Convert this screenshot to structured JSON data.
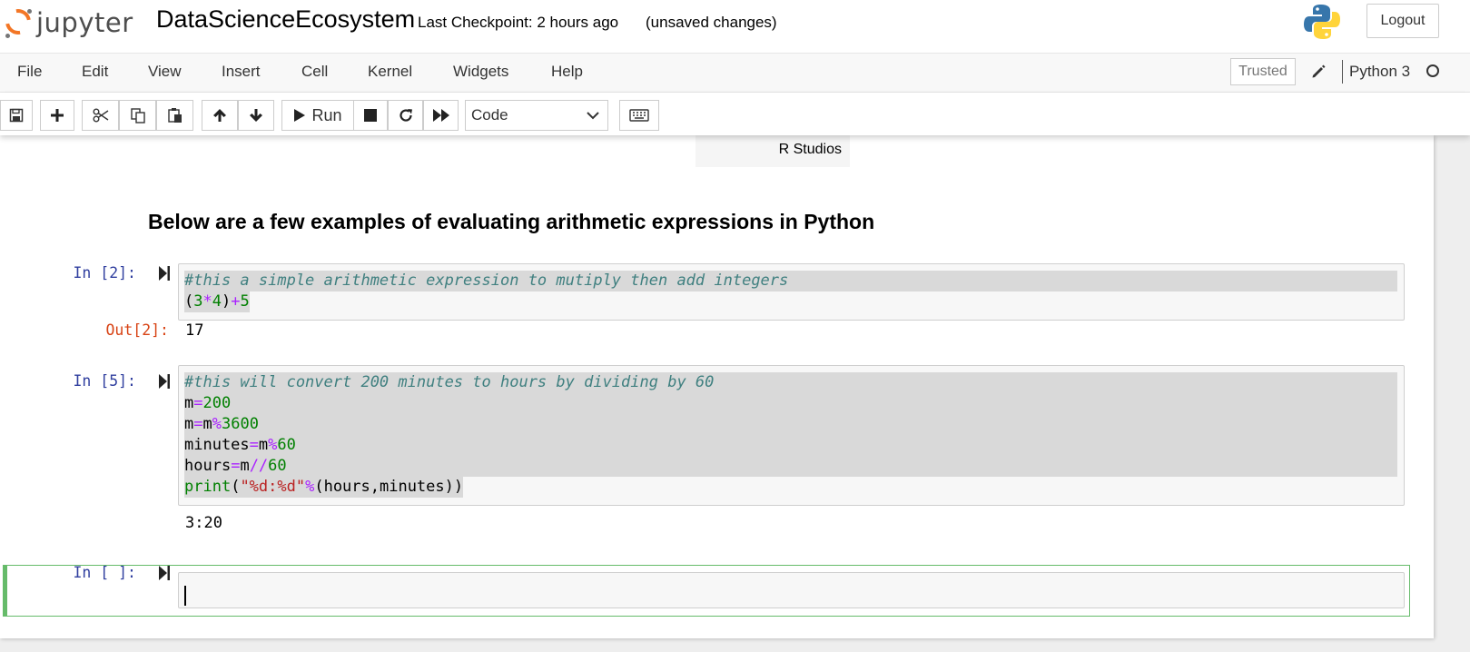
{
  "header": {
    "logo_text": "jupyter",
    "notebook_title": "DataScienceEcosystem",
    "checkpoint": "Last Checkpoint: 2 hours ago",
    "autosave_status": "(unsaved changes)",
    "logout_label": "Logout"
  },
  "menubar": {
    "items": [
      "File",
      "Edit",
      "View",
      "Insert",
      "Cell",
      "Kernel",
      "Widgets",
      "Help"
    ],
    "trusted_label": "Trusted",
    "kernel_name": "Python 3"
  },
  "toolbar": {
    "run_label": "Run",
    "cell_type": "Code",
    "icons": [
      "save-icon",
      "plus-icon",
      "cut-icon",
      "copy-icon",
      "paste-icon",
      "arrow-up-icon",
      "arrow-down-icon",
      "run-icon",
      "stop-icon",
      "restart-icon",
      "fast-forward-icon",
      "keyboard-icon"
    ]
  },
  "notebook": {
    "table_fragment": "R Studios",
    "heading": "Below are a few examples of evaluating arithmetic expressions in Python",
    "cells": [
      {
        "prompt": "In [2]:",
        "code_lines": [
          "#this a simple arithmetic expression to mutiply then add integers",
          "(3*4)+5"
        ],
        "out_prompt": "Out[2]:",
        "output": "17"
      },
      {
        "prompt": "In [5]:",
        "code_lines": [
          "#this will convert 200 minutes to hours by dividing by 60",
          "m=200",
          "m=m%3600",
          "minutes=m%60",
          "hours=m//60",
          "print(\"%d:%d\"%(hours,minutes))"
        ],
        "output": "3:20"
      },
      {
        "prompt": "In [ ]:",
        "code_lines": []
      }
    ]
  },
  "colors": {
    "jupyter_orange": "#f37626",
    "prompt_in": "#303f9f",
    "prompt_out": "#d84315",
    "selected_cell_border": "#66bb6a"
  }
}
